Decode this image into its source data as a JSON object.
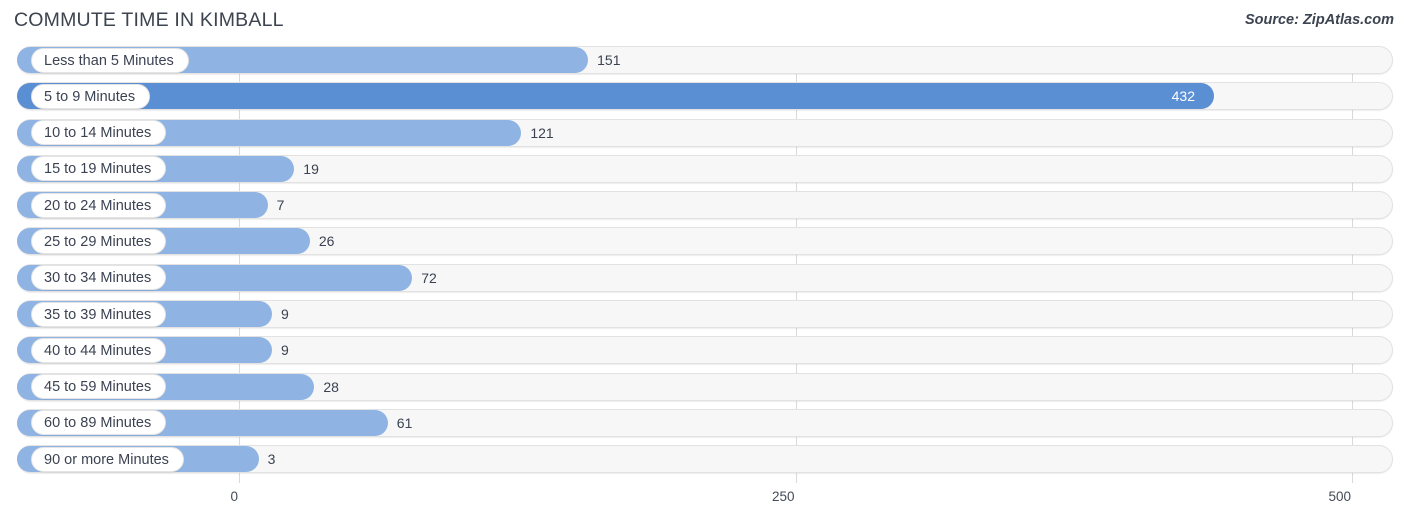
{
  "header": {
    "title": "COMMUTE TIME IN KIMBALL",
    "source": "Source: ZipAtlas.com"
  },
  "colors": {
    "bar": "#8FB4E3",
    "bar_highlight": "#5B8FD4",
    "track": "#F7F7F7",
    "gridline": "#D9D9D9",
    "text": "#3B4252"
  },
  "chart_data": {
    "type": "bar",
    "orientation": "horizontal",
    "title": "COMMUTE TIME IN KIMBALL",
    "xlabel": "",
    "ylabel": "",
    "xlim": [
      0,
      500
    ],
    "ticks": [
      "0",
      "250",
      "500"
    ],
    "tick_values": [
      0,
      250,
      500
    ],
    "grid": true,
    "legend": "none",
    "highlight_index": 1,
    "categories": [
      "Less than 5 Minutes",
      "5 to 9 Minutes",
      "10 to 14 Minutes",
      "15 to 19 Minutes",
      "20 to 24 Minutes",
      "25 to 29 Minutes",
      "30 to 34 Minutes",
      "35 to 39 Minutes",
      "40 to 44 Minutes",
      "45 to 59 Minutes",
      "60 to 89 Minutes",
      "90 or more Minutes"
    ],
    "values": [
      151,
      432,
      121,
      19,
      7,
      26,
      72,
      9,
      9,
      28,
      61,
      3
    ],
    "labels": [
      "151",
      "432",
      "121",
      "19",
      "7",
      "26",
      "72",
      "9",
      "9",
      "28",
      "61",
      "3"
    ]
  }
}
